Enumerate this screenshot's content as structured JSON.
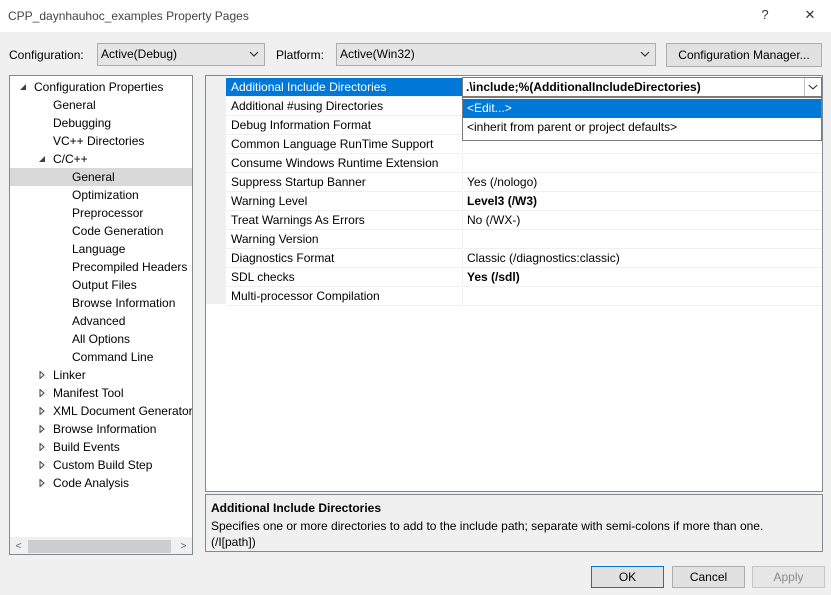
{
  "window": {
    "title": "CPP_daynhauhoc_examples Property Pages",
    "help_label": "?",
    "close_label": "✕"
  },
  "toolbar": {
    "configuration_label": "Configuration:",
    "configuration_value": "Active(Debug)",
    "platform_label": "Platform:",
    "platform_value": "Active(Win32)",
    "config_manager_label": "Configuration Manager..."
  },
  "tree": {
    "items": [
      {
        "label": "Configuration Properties"
      },
      {
        "label": "General"
      },
      {
        "label": "Debugging"
      },
      {
        "label": "VC++ Directories"
      },
      {
        "label": "C/C++"
      },
      {
        "label": "General"
      },
      {
        "label": "Optimization"
      },
      {
        "label": "Preprocessor"
      },
      {
        "label": "Code Generation"
      },
      {
        "label": "Language"
      },
      {
        "label": "Precompiled Headers"
      },
      {
        "label": "Output Files"
      },
      {
        "label": "Browse Information"
      },
      {
        "label": "Advanced"
      },
      {
        "label": "All Options"
      },
      {
        "label": "Command Line"
      },
      {
        "label": "Linker"
      },
      {
        "label": "Manifest Tool"
      },
      {
        "label": "XML Document Generator"
      },
      {
        "label": "Browse Information"
      },
      {
        "label": "Build Events"
      },
      {
        "label": "Custom Build Step"
      },
      {
        "label": "Code Analysis"
      }
    ],
    "scroll_left": "<",
    "scroll_right": ">"
  },
  "grid": {
    "rows": [
      {
        "name": "Additional Include Directories",
        "value": ""
      },
      {
        "name": "Additional #using Directories",
        "value": ""
      },
      {
        "name": "Debug Information Format",
        "value": ""
      },
      {
        "name": "Common Language RunTime Support",
        "value": ""
      },
      {
        "name": "Consume Windows Runtime Extension",
        "value": ""
      },
      {
        "name": "Suppress Startup Banner",
        "value": "Yes (/nologo)"
      },
      {
        "name": "Warning Level",
        "value": "Level3 (/W3)"
      },
      {
        "name": "Treat Warnings As Errors",
        "value": "No (/WX-)"
      },
      {
        "name": "Warning Version",
        "value": ""
      },
      {
        "name": "Diagnostics Format",
        "value": "Classic (/diagnostics:classic)"
      },
      {
        "name": "SDL checks",
        "value": "Yes (/sdl)"
      },
      {
        "name": "Multi-processor Compilation",
        "value": ""
      }
    ],
    "editor_value": ".\\include;%(AdditionalIncludeDirectories)",
    "dropdown": [
      {
        "label": "<Edit...>"
      },
      {
        "label": "<inherit from parent or project defaults>"
      }
    ]
  },
  "description": {
    "title": "Additional Include Directories",
    "text": "Specifies one or more directories to add to the include path; separate with semi-colons if more than one.     (/I[path])"
  },
  "buttons": {
    "ok": "OK",
    "cancel": "Cancel",
    "apply": "Apply"
  },
  "colors": {
    "selection": "#0078d7",
    "tree_selection": "#d9d9d9"
  }
}
